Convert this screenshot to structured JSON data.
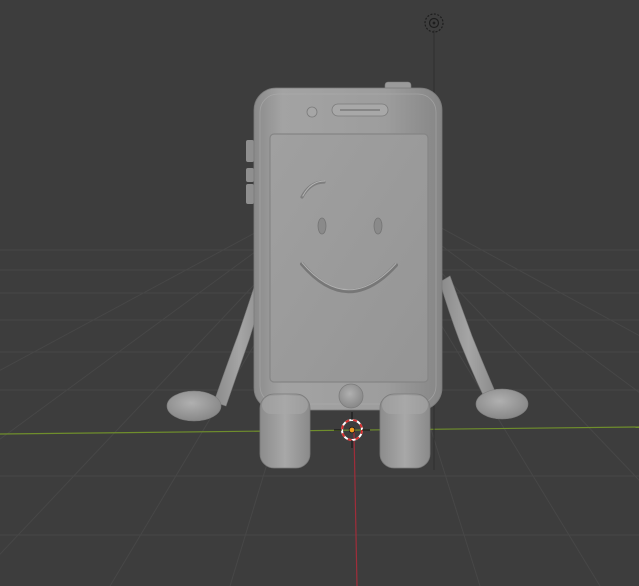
{
  "viewport": {
    "background": "#3d3d3d",
    "grid_color": "#474747",
    "x_axis_color": "#6f8e2c",
    "z_axis_color": "#a02d3a"
  },
  "scene": {
    "object_color": "#9b9b9b",
    "object_highlight": "#b3b3b3",
    "object_shadow": "#6e6e6e"
  },
  "gizmos": {
    "cursor_icon": "3d-cursor-icon",
    "origin_icon": "origin-point-icon",
    "light_icon": "light-icon"
  }
}
